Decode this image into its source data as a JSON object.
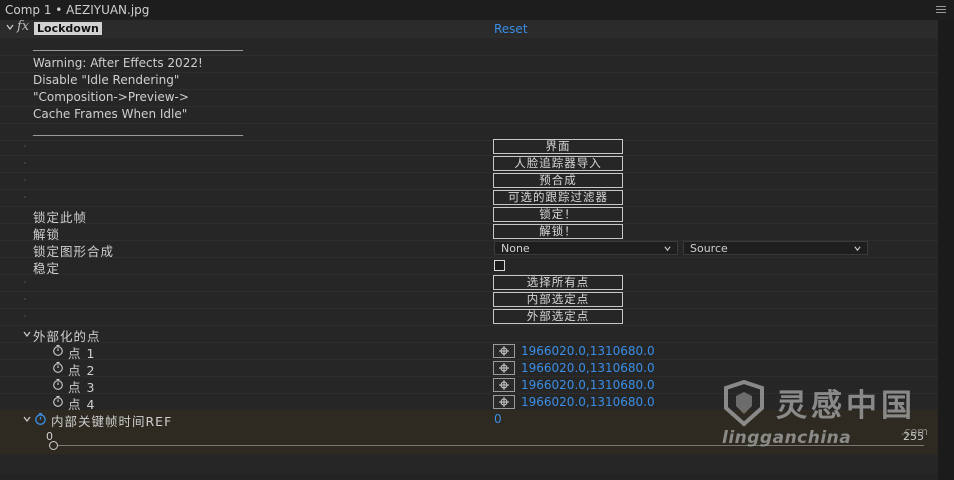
{
  "window": {
    "title": "Comp 1 • AEZIYUAN.jpg"
  },
  "effect": {
    "fx_symbol": "fx",
    "name": "Lockdown",
    "reset_label": "Reset"
  },
  "notes": [
    "___________________________________",
    "Warning: After Effects 2022!",
    "Disable \"Idle Rendering\"",
    "\"Composition->Preview->",
    "Cache Frames When Idle\"",
    "___________________________________"
  ],
  "buttons": {
    "interface": "界面",
    "face_tracker_import": "人脸追踪器导入",
    "precompose": "预合成",
    "optional_track_filter": "可选的跟踪过滤器",
    "lock": "锁定！",
    "unlock": "解锁！",
    "select_all_points": "选择所有点",
    "internal_selected_point_1": "内部选定点",
    "internal_selected_point_2": "外部选定点"
  },
  "labels": {
    "lock_this_frame": "锁定此帧",
    "unlock": "解锁",
    "lock_shape_comp": "锁定图形合成",
    "stabilize": "稳定",
    "externalized_points": "外部化的点",
    "internal_keyframe_ref": "内部关键帧时间REF"
  },
  "dropdowns": {
    "layer": {
      "value": "None"
    },
    "source": {
      "value": "Source"
    }
  },
  "stabilize_checked": false,
  "points": [
    {
      "label": "点 1",
      "value": "1966020.0,1310680.0"
    },
    {
      "label": "点 2",
      "value": "1966020.0,1310680.0"
    },
    {
      "label": "点 3",
      "value": "1966020.0,1310680.0"
    },
    {
      "label": "点 4",
      "value": "1966020.0,1310680.0"
    }
  ],
  "keyframe_ref": {
    "value": "0",
    "slider_min": "0",
    "slider_max": "255",
    "slider_level": 0
  },
  "watermark": {
    "brand": "灵感中国",
    "url": "lingganchina",
    "suffix": ".com"
  },
  "colors": {
    "accent_blue": "#3a8ee6",
    "panel_bg": "#262626",
    "keyframe_row_bg": "#2e2a21"
  }
}
